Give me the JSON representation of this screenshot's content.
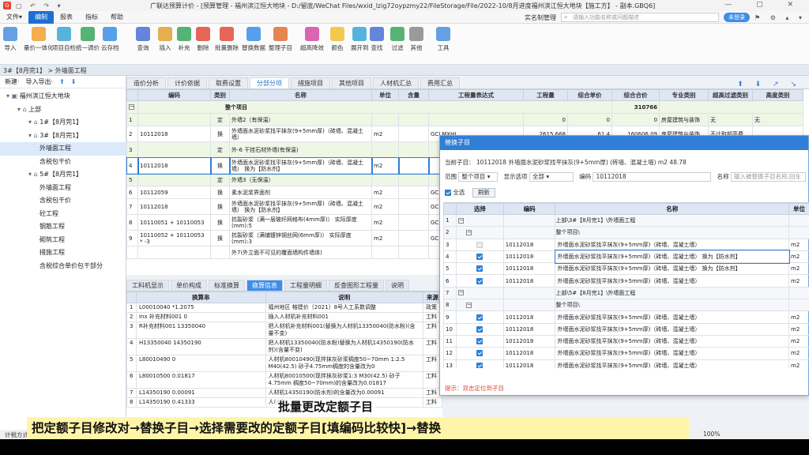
{
  "window": {
    "title": "广联达预算计价 - [预算管理 - 福州滨江恒大地块 - D:/留底/WeChat Files/wxid_lzig72oypzmy22/FileStorage/File/2022-10/8月进度福州滨江恒大地块【施工方】 - 副本.GBQ6]"
  },
  "menu": {
    "items": [
      "文件▾",
      "编制",
      "报表",
      "指标",
      "帮助"
    ],
    "realname": "实名制管理",
    "search_placeholder": "请输入功能名称或问题描述",
    "login": "未登录"
  },
  "toolbar": {
    "items": [
      {
        "label": "导入",
        "color": "#4a8fe0"
      },
      {
        "label": "量价一体化",
        "color": "#f0a030"
      },
      {
        "label": "项目自检",
        "color": "#3aa6d6"
      },
      {
        "label": "统一调价",
        "color": "#3aa65a"
      },
      {
        "label": "云存档",
        "color": "#3a8ee6"
      },
      {
        "label": "查询",
        "color": "#4a6fd6"
      },
      {
        "label": "插入",
        "color": "#e0a030"
      },
      {
        "label": "补充",
        "color": "#3aa65a"
      },
      {
        "label": "删除",
        "color": "#e04a3a"
      },
      {
        "label": "批量删除",
        "color": "#e04a3a"
      },
      {
        "label": "替换数据",
        "color": "#3a8ee6"
      },
      {
        "label": "整理子目",
        "color": "#e07030"
      },
      {
        "label": "超高降效",
        "color": "#d44aa6"
      },
      {
        "label": "颜色",
        "color": "#f0c030"
      },
      {
        "label": "展开到",
        "color": "#3aa6d6"
      },
      {
        "label": "查找",
        "color": "#4a6fd6"
      },
      {
        "label": "过滤",
        "color": "#3aa65a"
      },
      {
        "label": "其他",
        "color": "#888888"
      },
      {
        "label": "工具",
        "color": "#4a8fe0"
      }
    ]
  },
  "nav": {
    "breadcrumb": "3#【8月完1】 > 外墙面工程"
  },
  "left_panel": {
    "new_label": "新建·",
    "import_label": "导入导出·",
    "tree": [
      {
        "label": "福州滨江恒大地块",
        "level": 0,
        "icon": "▣"
      },
      {
        "label": "上部",
        "level": 1,
        "icon": "⌂"
      },
      {
        "label": "1#【8月完1】",
        "level": 2,
        "icon": "⌂"
      },
      {
        "label": "3#【8月完1】",
        "level": 2,
        "icon": "⌂"
      },
      {
        "label": "外墙面工程",
        "level": 3,
        "icon": "",
        "selected": true
      },
      {
        "label": "含税包干价",
        "level": 3,
        "icon": ""
      },
      {
        "label": "5#【8月完1】",
        "level": 2,
        "icon": "⌂"
      },
      {
        "label": "外墙面工程",
        "level": 3,
        "icon": ""
      },
      {
        "label": "含税包干价",
        "level": 3,
        "icon": ""
      },
      {
        "label": "砼工程",
        "level": 3,
        "icon": ""
      },
      {
        "label": "钢筋工程",
        "level": 3,
        "icon": ""
      },
      {
        "label": "砌筑工程",
        "level": 3,
        "icon": ""
      },
      {
        "label": "措施工程",
        "level": 3,
        "icon": ""
      },
      {
        "label": "含税综合单价包干部分",
        "level": 3,
        "icon": ""
      }
    ]
  },
  "main_tabs": [
    "造价分析",
    "计价依据",
    "取费设置",
    "分部分项",
    "措施项目",
    "其他项目",
    "人材机汇总",
    "费用汇总"
  ],
  "main_grid": {
    "headers": [
      "",
      "编码",
      "类别",
      "名称",
      "单位",
      "含量",
      "工程量表达式",
      "工程量",
      "综合单价",
      "综合合价",
      "专业类别",
      "超高过滤类别",
      "高度类别"
    ],
    "total_label": "整个项目",
    "total_value": "310766",
    "rows": [
      {
        "no": "1",
        "code": "",
        "type": "定",
        "name": "外墙2（有保温）",
        "unit": "",
        "qty": "",
        "expr": "",
        "amount": "0",
        "price": "0",
        "total": "0",
        "spec": "房屋建筑与装饰",
        "filter": "无",
        "height": "无",
        "grp": true
      },
      {
        "no": "2",
        "code": "10112018",
        "type": "换",
        "name": "外墙面水泥砂浆找平抹灰(9+5mm厚)（砖墙、混凝土墙）",
        "unit": "m2",
        "qty": "",
        "expr": "GCLMXHJ",
        "amount": "2615.668",
        "price": "61.4",
        "total": "160606.09",
        "spec": "房屋建筑与装饰",
        "filter": "不计取超高费",
        "height": ""
      },
      {
        "no": "3",
        "code": "",
        "type": "定",
        "name": "外-6 干挂石材外墙(有保温)",
        "unit": "",
        "qty": "",
        "expr": "",
        "amount": "",
        "price": "",
        "total": "",
        "spec": "",
        "filter": "",
        "height": "",
        "grp": true
      },
      {
        "no": "4",
        "code": "10112018",
        "type": "换",
        "name": "外墙面水泥砂浆找平抹灰(9+5mm厚)（砖墙、混凝土墙） 换为【防水剂】",
        "unit": "m2",
        "qty": "",
        "expr": "",
        "amount": "",
        "price": "",
        "total": "",
        "spec": "",
        "filter": "",
        "height": ""
      },
      {
        "no": "5",
        "code": "",
        "type": "定",
        "name": "外墙3（无保温）",
        "unit": "",
        "qty": "",
        "expr": "",
        "amount": "",
        "price": "",
        "total": "",
        "spec": "",
        "filter": "",
        "height": "",
        "grp": true
      },
      {
        "no": "6",
        "code": "10112059",
        "type": "换",
        "name": "素水泥浆界面剂",
        "unit": "m2",
        "qty": "",
        "expr": "GC",
        "amount": "",
        "price": "",
        "total": "",
        "spec": "",
        "filter": "",
        "height": ""
      },
      {
        "no": "7",
        "code": "10112018",
        "type": "换",
        "name": "外墙面水泥砂浆找平抹灰(9+5mm厚)（砖墙、混凝土墙） 换为【防水剂】",
        "unit": "m2",
        "qty": "",
        "expr": "GC",
        "amount": "",
        "price": "",
        "total": "",
        "spec": "",
        "filter": "",
        "height": ""
      },
      {
        "no": "8",
        "code": "10110051 + 10110053",
        "type": "换",
        "name": "抗裂砂浆（满一层玻纤网格布(4mm厚)） 实际厚度(mm):5",
        "unit": "m2",
        "qty": "",
        "expr": "GC",
        "amount": "",
        "price": "",
        "total": "",
        "spec": "",
        "filter": "",
        "height": ""
      },
      {
        "no": "9",
        "code": "10110052 + 10110053 * -3",
        "type": "换",
        "name": "抗裂砂浆（满铺镀锌钢丝网(6mm厚)） 实际厚度(mm):3",
        "unit": "m2",
        "qty": "",
        "expr": "GC",
        "amount": "",
        "price": "",
        "total": "",
        "spec": "",
        "filter": "",
        "height": ""
      },
      {
        "no": "",
        "code": "",
        "type": "",
        "name": "外7(外立面不可见的覆面墙构件墙体)",
        "unit": "",
        "qty": "",
        "expr": "",
        "amount": "",
        "price": "",
        "total": "",
        "spec": "",
        "filter": "",
        "height": ""
      }
    ]
  },
  "bottom_tabs": [
    "工料机显示",
    "单价构成",
    "标准换算",
    "换算信息",
    "工程量明细",
    "反查图形工程量",
    "说明"
  ],
  "bottom_grid": {
    "headers": [
      "",
      "换算串",
      "说明",
      "来源"
    ],
    "rows": [
      {
        "no": "1",
        "expr": "L00010040 *1.2075",
        "desc": "福州地区 榕建价〔2021〕8号人工系数调整",
        "src": "政策"
      },
      {
        "no": "2",
        "expr": "Inx 补充材料001 0",
        "desc": "插入人材机补充材料001",
        "src": "工料"
      },
      {
        "no": "3",
        "expr": "R补充材料001 13350040",
        "desc": "把人材机补充材料001(替换为人材机13350040(防水粉)(含量不变)",
        "src": "工料"
      },
      {
        "no": "4",
        "expr": "H13350040 14350190",
        "desc": "把人材机13350040(防水粉)替换为人材机14350190(防水剂)(含量不变)",
        "src": "工料"
      },
      {
        "no": "5",
        "expr": "L80010490 0",
        "desc": "人材机80010490(现拌抹灰砂浆稠度50~70mm 1:2.5 M40(42.5) 砂子4.75mm稠度的含量改为0",
        "src": "工料"
      },
      {
        "no": "6",
        "expr": "L80010500 0.01817",
        "desc": "人材机80010500(现拌抹灰砂浆1:3 M30(42.5) 砂子4.75mm 稠度50~70mm)的含量改为0.01817",
        "src": "工料"
      },
      {
        "no": "7",
        "expr": "L14350190 0.00091",
        "desc": "人材机14350190(防水剂)的含量改为0.00091",
        "src": "工料"
      },
      {
        "no": "8",
        "expr": "L14350190 0.41333",
        "desc": "人材机",
        "src": "工料"
      }
    ]
  },
  "dialog": {
    "title": "替换子目",
    "current_label": "当前子目：",
    "current_value": "10112018 外墙面水泥砂浆找平抹灰(9+5mm厚) (砖墙、混凝土墙) m2 48.78",
    "scope_label": "范围",
    "scope_value": "整个项目",
    "display_label": "显示选项",
    "display_value": "全部",
    "code_label": "编码",
    "code_value": "10112018",
    "name_label": "名称",
    "name_placeholder": "输入被替换子目名称,回车",
    "select_all": "全选",
    "refresh": "刷新",
    "headers": [
      "",
      "选择",
      "编码",
      "名称",
      "单位"
    ],
    "rows": [
      {
        "no": "1",
        "check": "",
        "code": "",
        "name": "上部\\3#【8月完1】\\外墙面工程",
        "unit": "",
        "grp": true,
        "tree": "minus"
      },
      {
        "no": "2",
        "check": "",
        "code": "",
        "name": "整个项目\\",
        "unit": "",
        "grp": true,
        "tree": "minus2"
      },
      {
        "no": "3",
        "check": "dis",
        "code": "10112018",
        "name": "外墙面水泥砂浆找平抹灰(9+5mm厚)（砖墙、混凝土墙）",
        "unit": "m2"
      },
      {
        "no": "4",
        "check": "on",
        "code": "10112018",
        "name": "外墙面水泥砂浆找平抹灰(9+5mm厚)（砖墙、混凝土墙） 换为【防水剂】",
        "unit": "m2",
        "sel": true
      },
      {
        "no": "5",
        "check": "on",
        "code": "10112018",
        "name": "外墙面水泥砂浆找平抹灰(9+5mm厚)（砖墙、混凝土墙） 换为【防水剂】",
        "unit": "m2"
      },
      {
        "no": "6",
        "check": "on",
        "code": "10112018",
        "name": "外墙面水泥砂浆找平抹灰(9+5mm厚)（砖墙、混凝土墙）",
        "unit": "m2"
      },
      {
        "no": "7",
        "check": "",
        "code": "",
        "name": "上部\\5#【8月完1】\\外墙面工程",
        "unit": "",
        "grp": true,
        "tree": "minus"
      },
      {
        "no": "8",
        "check": "",
        "code": "",
        "name": "整个项目\\",
        "unit": "",
        "grp": true,
        "tree": "minus2"
      },
      {
        "no": "9",
        "check": "on",
        "code": "10112018",
        "name": "外墙面水泥砂浆找平抹灰(9+5mm厚)（砖墙、混凝土墙）",
        "unit": "m2"
      },
      {
        "no": "10",
        "check": "on",
        "code": "10112018",
        "name": "外墙面水泥砂浆找平抹灰(9+5mm厚)（砖墙、混凝土墙）",
        "unit": "m2"
      },
      {
        "no": "11",
        "check": "on",
        "code": "10112018",
        "name": "外墙面水泥砂浆找平抹灰(9+5mm厚)（砖墙、混凝土墙）",
        "unit": "m2"
      },
      {
        "no": "12",
        "check": "on",
        "code": "10112018",
        "name": "外墙面水泥砂浆找平抹灰(9+5mm厚)（砖墙、混凝土墙）",
        "unit": "m2"
      },
      {
        "no": "13",
        "check": "on",
        "code": "10112018",
        "name": "外墙面水泥砂浆找平抹灰(9+5mm厚)（砖墙、混凝土墙）",
        "unit": "m2"
      }
    ],
    "hint": "提示：双击定位到子目"
  },
  "status": {
    "left": "计税方式",
    "zoom": "100%"
  },
  "captions": {
    "top": "批量更改定额子目",
    "bottom": "把定额子目修改对→替换子目→选择需要改的定额子目[填编码比较快]→替换"
  }
}
